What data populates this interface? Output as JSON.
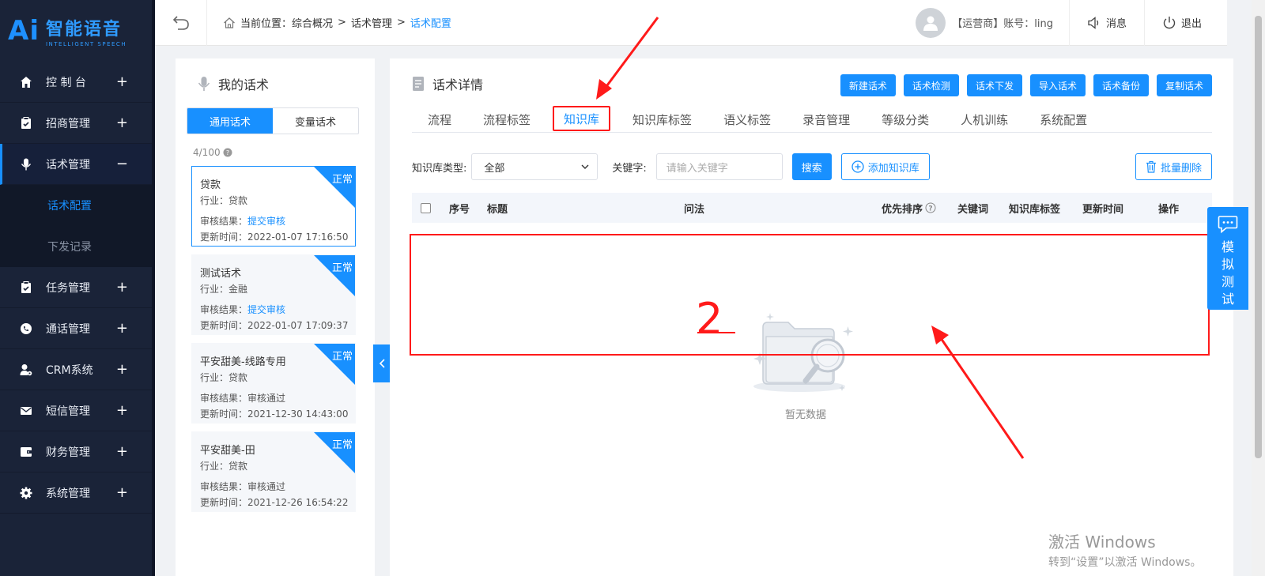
{
  "logo": {
    "mark": "Ai",
    "name_cn": "智能语音",
    "name_en": "INTELLIGENT SPEECH"
  },
  "sidebar": {
    "items": [
      {
        "label": "控 制 台",
        "icon": "home-icon",
        "sign": "+"
      },
      {
        "label": "招商管理",
        "icon": "clipboard-icon",
        "sign": "+"
      },
      {
        "label": "话术管理",
        "icon": "microphone-icon",
        "sign": "−",
        "active": true
      },
      {
        "label": "任务管理",
        "icon": "clipboard-check-icon",
        "sign": "+"
      },
      {
        "label": "通话管理",
        "icon": "phone-circle-icon",
        "sign": "+"
      },
      {
        "label": "CRM系统",
        "icon": "user-gear-icon",
        "sign": "+"
      },
      {
        "label": "短信管理",
        "icon": "mail-icon",
        "sign": "+"
      },
      {
        "label": "财务管理",
        "icon": "wallet-icon",
        "sign": "+"
      },
      {
        "label": "系统管理",
        "icon": "gear-icon",
        "sign": "+"
      }
    ],
    "submenu": [
      {
        "label": "话术配置",
        "active": true
      },
      {
        "label": "下发记录"
      }
    ]
  },
  "header": {
    "breadcrumb_prefix": "当前位置：",
    "crumb1": "综合概况",
    "sep": ">",
    "crumb2": "话术管理",
    "crumb3": "话术配置",
    "account": "【运营商】账号：ling",
    "message": "消息",
    "logout": "退出"
  },
  "left_panel": {
    "title": "我的话术",
    "tab_general": "通用话术",
    "tab_variable": "变量话术",
    "count": "4/100",
    "cards": [
      {
        "name": "贷款",
        "industry": "行业：贷款",
        "audit_label": "审核结果：",
        "audit_value": "提交审核",
        "audit_link": true,
        "updated": "更新时间：2022-01-07 17:16:50",
        "status": "正常"
      },
      {
        "name": "测试话术",
        "industry": "行业：金融",
        "audit_label": "审核结果：",
        "audit_value": "提交审核",
        "audit_link": true,
        "updated": "更新时间：2022-01-07 17:09:37",
        "status": "正常"
      },
      {
        "name": "平安甜美-线路专用",
        "industry": "行业：贷款",
        "audit_label": "审核结果：",
        "audit_value": "审核通过",
        "audit_link": false,
        "updated": "更新时间：2021-12-30 14:43:00",
        "status": "正常"
      },
      {
        "name": "平安甜美-田",
        "industry": "行业：贷款",
        "audit_label": "审核结果：",
        "audit_value": "审核通过",
        "audit_link": false,
        "updated": "更新时间：2021-12-26 16:54:22",
        "status": "正常"
      }
    ]
  },
  "main": {
    "title": "话术详情",
    "actions": [
      "新建话术",
      "话术检测",
      "话术下发",
      "导入话术",
      "话术备份",
      "复制话术"
    ],
    "tabs": [
      "流程",
      "流程标签",
      "知识库",
      "知识库标签",
      "语义标签",
      "录音管理",
      "等级分类",
      "人机训练",
      "系统配置"
    ],
    "active_tab": "知识库",
    "filter": {
      "type_label": "知识库类型:",
      "type_value": "全部",
      "keyword_label": "关键字:",
      "keyword_placeholder": "请输入关键字",
      "search": "搜索",
      "add": "添加知识库",
      "batch_delete": "批量删除"
    },
    "columns": [
      "序号",
      "标题",
      "问法",
      "优先排序",
      "关键词",
      "知识库标签",
      "更新时间",
      "操作"
    ],
    "empty_text": "暂无数据"
  },
  "floating": {
    "sim_test": [
      "模",
      "拟",
      "测",
      "试"
    ]
  },
  "annotation": {
    "number": "2"
  },
  "watermark": {
    "line1": "激活 Windows",
    "line2": "转到“设置”以激活 Windows。"
  },
  "colors": {
    "primary": "#1890ff",
    "sidebar_bg": "#1a2338",
    "annotation_red": "#ff1a1a"
  }
}
